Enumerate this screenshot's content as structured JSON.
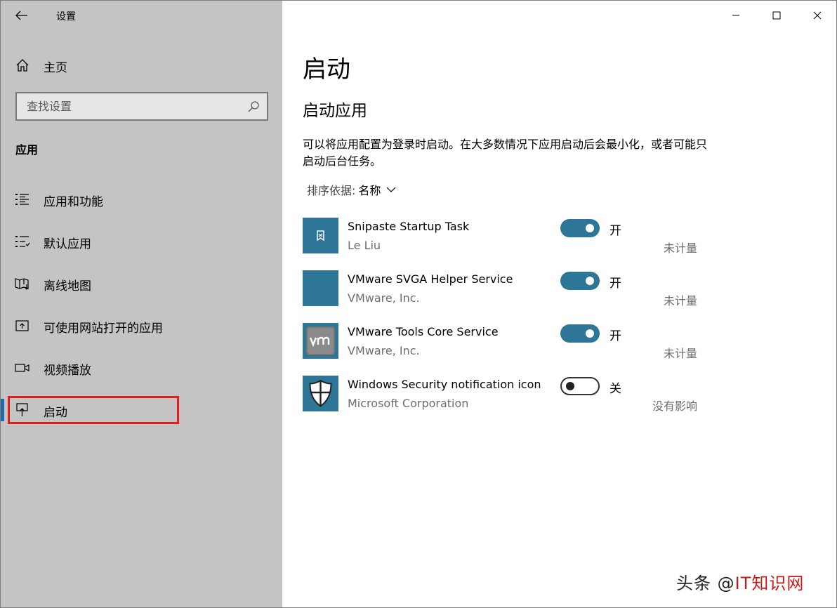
{
  "window": {
    "title": "设置",
    "controls": {
      "minimize": "minimize-icon",
      "maximize": "maximize-icon",
      "close": "close-icon"
    }
  },
  "sidebar": {
    "back_icon": "back-arrow-icon",
    "home_label": "主页",
    "search_placeholder": "查找设置",
    "section_title": "应用",
    "items": [
      {
        "label": "应用和功能",
        "icon": "apps-features-icon"
      },
      {
        "label": "默认应用",
        "icon": "default-apps-icon"
      },
      {
        "label": "离线地图",
        "icon": "offline-maps-icon"
      },
      {
        "label": "可使用网站打开的应用",
        "icon": "apps-for-websites-icon"
      },
      {
        "label": "视频播放",
        "icon": "video-playback-icon"
      },
      {
        "label": "启动",
        "icon": "startup-icon",
        "selected": true
      }
    ]
  },
  "main": {
    "title": "启动",
    "subtitle": "启动应用",
    "description": "可以将应用配置为登录时启动。在大多数情况下应用启动后会最小化，或者可能只启动后台任务。",
    "sort_label": "排序依据:",
    "sort_value": "名称",
    "apps": [
      {
        "name": "Snipaste Startup Task",
        "publisher": "Le Liu",
        "state": "开",
        "on": true,
        "impact": "未计量",
        "icon": "snipaste-icon"
      },
      {
        "name": "VMware SVGA Helper Service",
        "publisher": "VMware, Inc.",
        "state": "开",
        "on": true,
        "impact": "未计量",
        "icon": "vmware-svga-icon"
      },
      {
        "name": "VMware Tools Core Service",
        "publisher": "VMware, Inc.",
        "state": "开",
        "on": true,
        "impact": "未计量",
        "icon": "vmware-tools-icon"
      },
      {
        "name": "Windows Security notification icon",
        "publisher": "Microsoft Corporation",
        "state": "关",
        "on": false,
        "impact": "没有影响",
        "icon": "windows-security-icon"
      }
    ]
  },
  "colors": {
    "accent": "#2d7698",
    "sidebar_bg": "#c4c4c4",
    "highlight_box": "#e02020"
  },
  "watermark": {
    "part1": "头条 @",
    "part2": "IT知识网"
  }
}
